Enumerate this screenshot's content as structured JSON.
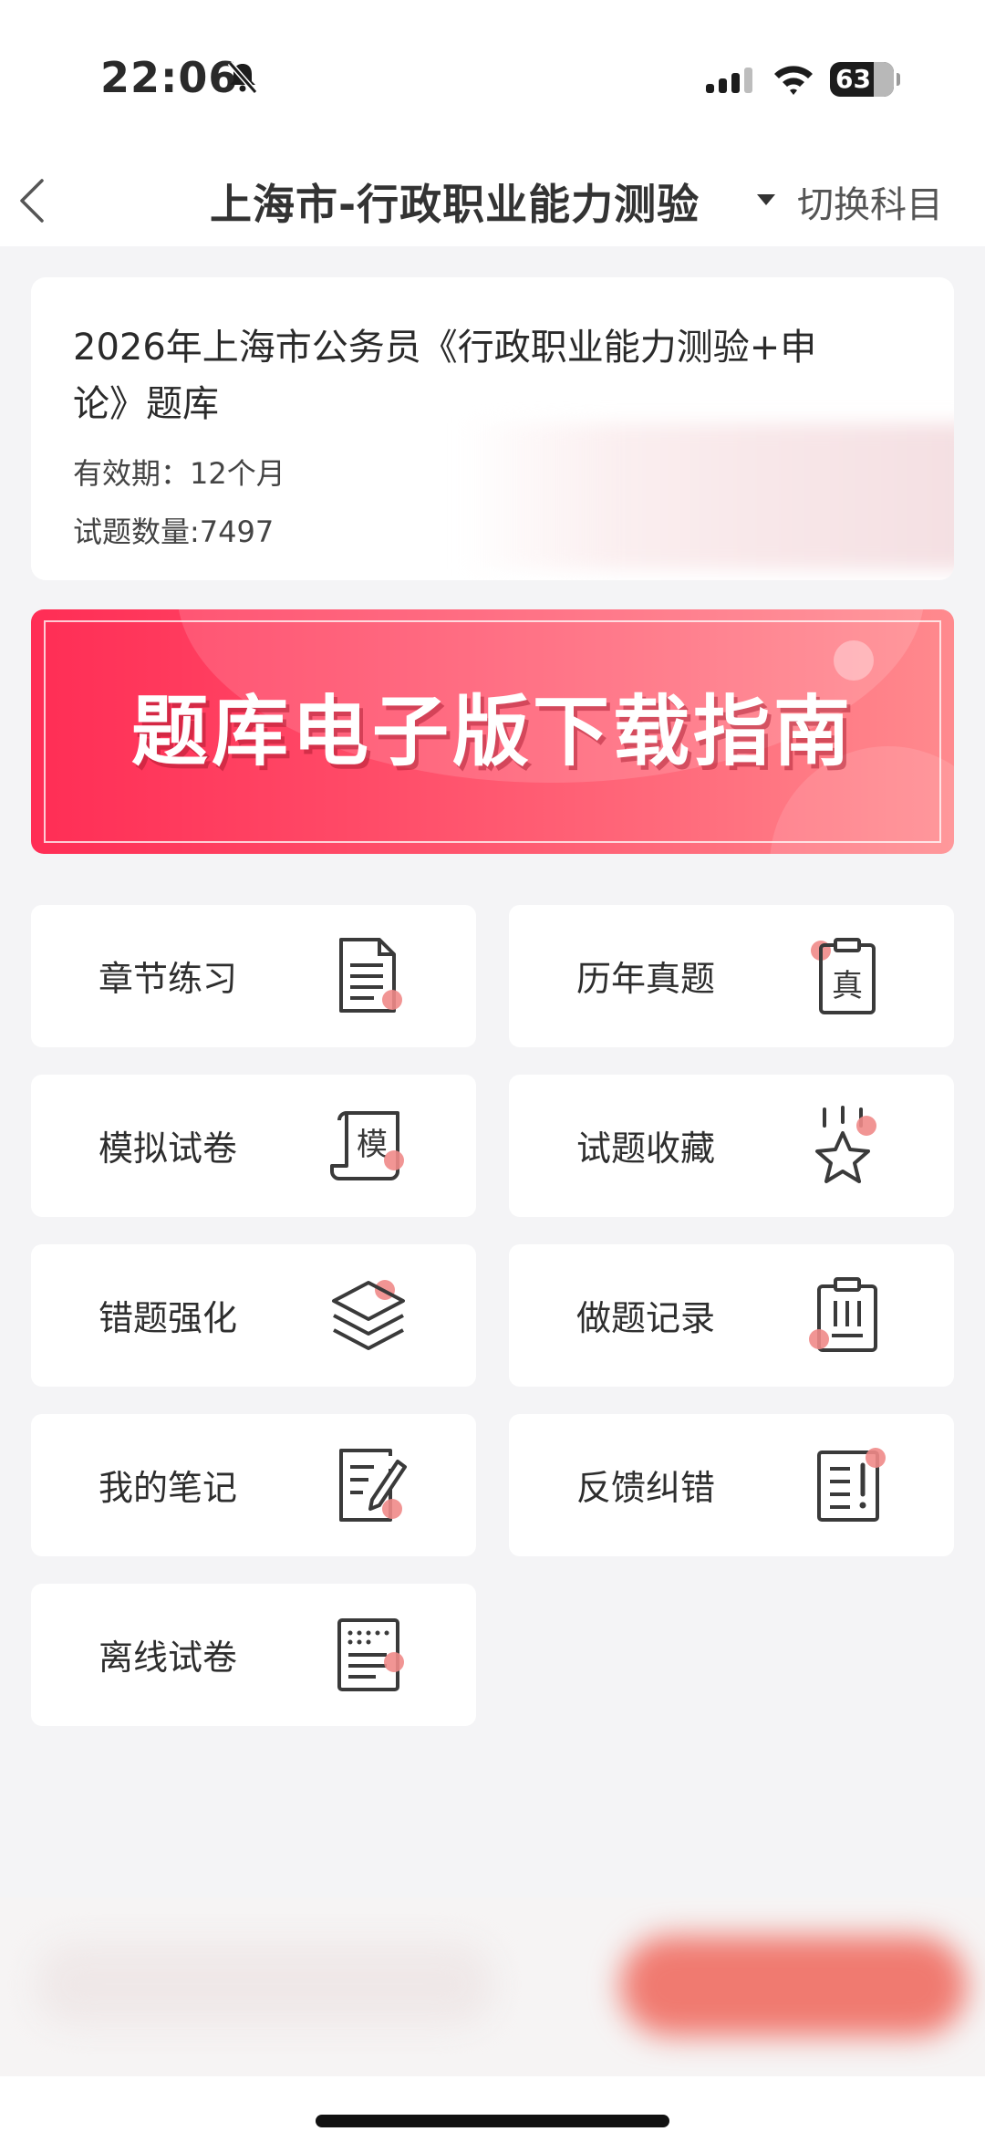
{
  "status_bar": {
    "time": "22:06",
    "battery": "63",
    "icons": [
      "bell-slash-icon",
      "signal-icon",
      "wifi-icon",
      "battery-icon"
    ]
  },
  "nav": {
    "back_icon": "chevron-left-icon",
    "title": "上海市-行政职业能力测验",
    "dropdown_icon": "caret-down-icon",
    "switch_label": "切换科目"
  },
  "info": {
    "title": "2026年上海市公务员《行政职业能力测验+申论》题库",
    "validity": "有效期：12个月",
    "question_count": "试题数量:7497"
  },
  "banner": {
    "text": "题库电子版下载指南",
    "color_start": "#ff2d55",
    "color_end": "#ff8a8e"
  },
  "menu": [
    {
      "label": "章节练习",
      "icon": "document-lines-icon"
    },
    {
      "label": "历年真题",
      "icon": "clipboard-zhen-icon"
    },
    {
      "label": "模拟试卷",
      "icon": "scroll-mo-icon"
    },
    {
      "label": "试题收藏",
      "icon": "star-icon"
    },
    {
      "label": "错题强化",
      "icon": "layers-icon"
    },
    {
      "label": "做题记录",
      "icon": "clipboard-list-icon"
    },
    {
      "label": "我的笔记",
      "icon": "note-pencil-icon"
    },
    {
      "label": "反馈纠错",
      "icon": "document-exclamation-icon"
    },
    {
      "label": "离线试卷",
      "icon": "document-grid-icon"
    }
  ],
  "theme": {
    "accent": "#ff4a67",
    "icon_dot": "#f08a88",
    "background": "#f4f4f6"
  }
}
